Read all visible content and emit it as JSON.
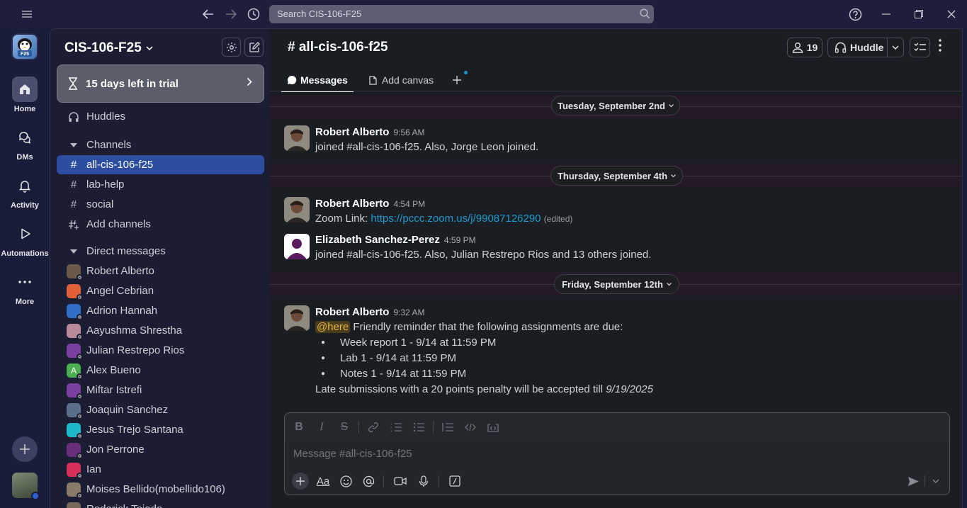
{
  "search": {
    "placeholder": "Search CIS-106-F25"
  },
  "rail": {
    "workspace_logo_text": "F25",
    "items": [
      {
        "label": "Home"
      },
      {
        "label": "DMs"
      },
      {
        "label": "Activity"
      },
      {
        "label": "Automations"
      },
      {
        "label": "More"
      }
    ]
  },
  "sidebar": {
    "workspace_name": "CIS-106-F25",
    "trial_text": "15 days left in trial",
    "huddles_label": "Huddles",
    "channels_header": "Channels",
    "channels": [
      {
        "name": "all-cis-106-f25",
        "active": true
      },
      {
        "name": "lab-help",
        "active": false
      },
      {
        "name": "social",
        "active": false
      }
    ],
    "add_channels_label": "Add channels",
    "dm_header": "Direct messages",
    "dms": [
      {
        "name": "Robert Alberto",
        "color": "#6b5a4a"
      },
      {
        "name": "Angel Cebrian",
        "color": "#e0603a"
      },
      {
        "name": "Adrion Hannah",
        "color": "#2f6fc7"
      },
      {
        "name": "Aayushma Shrestha",
        "color": "#b98a9a"
      },
      {
        "name": "Julian Restrepo Rios",
        "color": "#7a3fa0"
      },
      {
        "name": "Alex Bueno",
        "color": "#4caf50",
        "initial": "A"
      },
      {
        "name": "Miftar Istrefi",
        "color": "#7a3fa0"
      },
      {
        "name": "Joaquin Sanchez",
        "color": "#5b6e8a"
      },
      {
        "name": "Jesus Trejo Santana",
        "color": "#1eb8c8"
      },
      {
        "name": "Jon Perrone",
        "color": "#6a2f7a"
      },
      {
        "name": "Ian",
        "color": "#d9305a"
      },
      {
        "name": "Moises Bellido(mobellido106)",
        "color": "#8a7a6a"
      },
      {
        "name": "Roderick Tejada",
        "color": "#7a6a5a"
      }
    ]
  },
  "channel": {
    "title": "# all-cis-106-f25",
    "member_count": "19",
    "huddle_label": "Huddle",
    "tabs": [
      {
        "label": "Messages"
      },
      {
        "label": "Add canvas"
      }
    ]
  },
  "feed": {
    "days": [
      {
        "label": "Tuesday, September 2nd"
      },
      {
        "label": "Thursday, September 4th"
      },
      {
        "label": "Friday, September 12th"
      }
    ],
    "messages": [
      {
        "author": "Robert Alberto",
        "time": "9:56 AM",
        "text": "joined #all-cis-106-f25. Also, Jorge Leon joined."
      },
      {
        "author": "Robert Alberto",
        "time": "4:54 PM",
        "prefix": "Zoom Link: ",
        "link": "https://pccc.zoom.us/j/99087126290",
        "edited": "(edited)"
      },
      {
        "author": "Elizabeth Sanchez-Perez",
        "time": "4:59 PM",
        "text": "joined #all-cis-106-f25. Also, Julian Restrepo Rios and 13 others joined."
      },
      {
        "author": "Robert Alberto",
        "time": "9:32 AM",
        "mention": "@here",
        "text": " Friendly reminder that the following assignments are due:",
        "bullets": [
          "Week report 1 - 9/14  at 11:59 PM",
          "Lab 1  - 9/14 at 11:59 PM",
          "Notes 1 - 9/14 at 11:59 PM"
        ],
        "footer": "Late submissions with a  20 points penalty will be accepted till ",
        "footer_italic": "9/19/2025"
      }
    ]
  },
  "composer": {
    "placeholder": "Message #all-cis-106-f25",
    "fmt_bold": "B",
    "fmt_italic": "I",
    "fmt_strike": "S",
    "text_btn": "Aa"
  }
}
